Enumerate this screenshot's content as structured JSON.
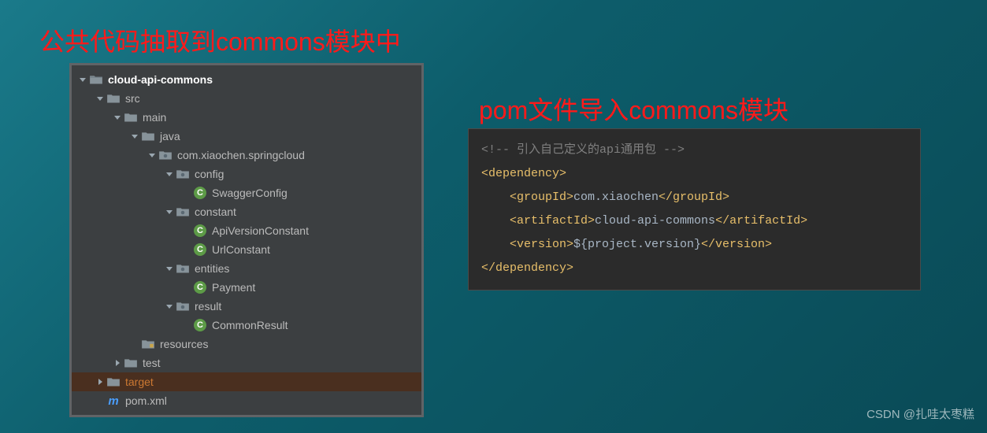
{
  "headings": {
    "left": "公共代码抽取到commons模块中",
    "right": "pom文件导入commons模块"
  },
  "tree": {
    "items": [
      {
        "indent": 0,
        "arrow": "down",
        "icon": "folder-open",
        "label": "cloud-api-commons",
        "bold": true
      },
      {
        "indent": 1,
        "arrow": "down",
        "icon": "folder-closed",
        "label": "src"
      },
      {
        "indent": 2,
        "arrow": "down",
        "icon": "folder-closed",
        "label": "main"
      },
      {
        "indent": 3,
        "arrow": "down",
        "icon": "folder-closed",
        "label": "java"
      },
      {
        "indent": 4,
        "arrow": "down",
        "icon": "pkg",
        "label": "com.xiaochen.springcloud"
      },
      {
        "indent": 5,
        "arrow": "down",
        "icon": "pkg",
        "label": "config"
      },
      {
        "indent": 6,
        "arrow": "none",
        "icon": "class",
        "label": "SwaggerConfig"
      },
      {
        "indent": 5,
        "arrow": "down",
        "icon": "pkg",
        "label": "constant"
      },
      {
        "indent": 6,
        "arrow": "none",
        "icon": "class",
        "label": "ApiVersionConstant"
      },
      {
        "indent": 6,
        "arrow": "none",
        "icon": "class",
        "label": "UrlConstant"
      },
      {
        "indent": 5,
        "arrow": "down",
        "icon": "pkg",
        "label": "entities"
      },
      {
        "indent": 6,
        "arrow": "none",
        "icon": "class",
        "label": "Payment"
      },
      {
        "indent": 5,
        "arrow": "down",
        "icon": "pkg",
        "label": "result"
      },
      {
        "indent": 6,
        "arrow": "none",
        "icon": "class",
        "label": "CommonResult"
      },
      {
        "indent": 3,
        "arrow": "none",
        "icon": "res",
        "label": "resources"
      },
      {
        "indent": 2,
        "arrow": "right",
        "icon": "folder-closed",
        "label": "test"
      },
      {
        "indent": 1,
        "arrow": "right",
        "icon": "folder-closed",
        "label": "target",
        "orange": true,
        "selected": true
      },
      {
        "indent": 1,
        "arrow": "none",
        "icon": "maven",
        "label": "pom.xml"
      }
    ]
  },
  "code": {
    "comment": "<!-- 引入自己定义的api通用包 -->",
    "dep_open": "<dependency>",
    "group_open": "<groupId>",
    "group_val": "com.xiaochen",
    "group_close": "</groupId>",
    "art_open": "<artifactId>",
    "art_val": "cloud-api-commons",
    "art_close": "</artifactId>",
    "ver_open": "<version>",
    "ver_val": "${project.version}",
    "ver_close": "</version>",
    "dep_close": "</dependency>"
  },
  "watermark": "CSDN @扎哇太枣糕"
}
